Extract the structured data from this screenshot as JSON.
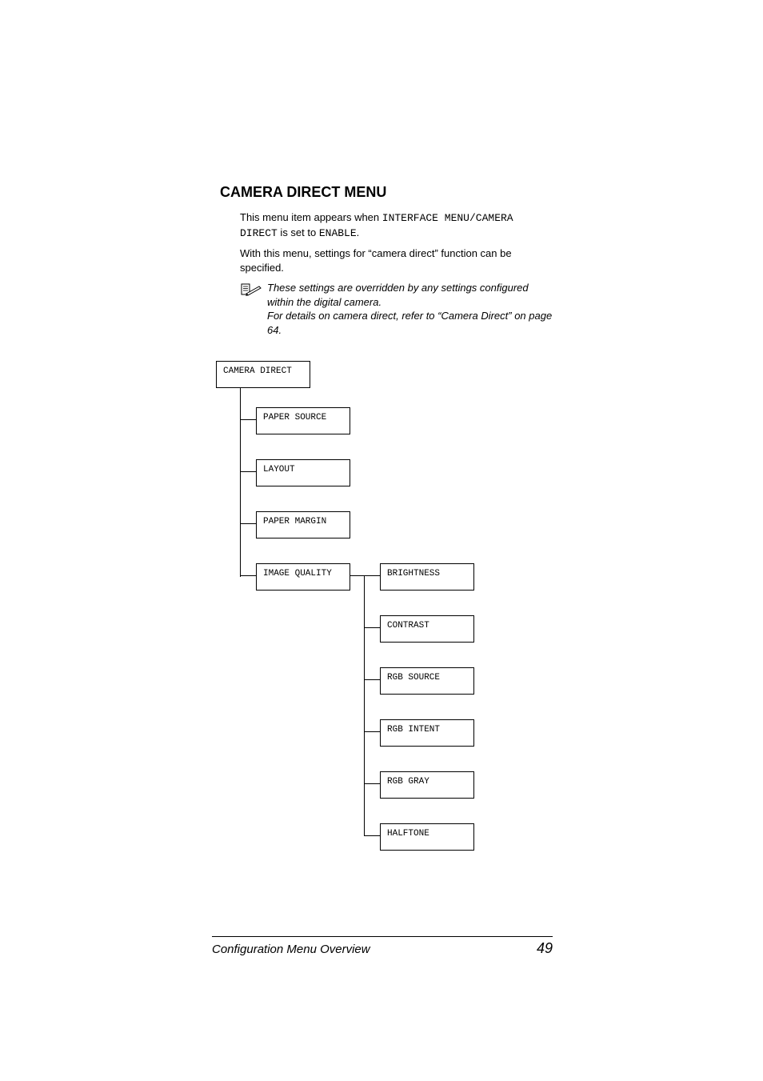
{
  "heading": "CAMERA DIRECT MENU",
  "intro": {
    "part1": "This menu item appears when ",
    "code1": "INTERFACE MENU/CAMERA DIRECT",
    "part2": " is set to ",
    "code2": "ENABLE",
    "part3": "."
  },
  "line2": "With this menu, settings for “camera direct” function can be specified.",
  "note": {
    "l1": "These settings are overridden by any settings configured within the digital camera.",
    "l2": "For details on camera direct, refer to “Camera Direct” on page 64."
  },
  "tree": {
    "root": "CAMERA DIRECT",
    "c1": "PAPER SOURCE",
    "c2": "LAYOUT",
    "c3": "PAPER MARGIN",
    "c4": "IMAGE QUALITY",
    "g1": "BRIGHTNESS",
    "g2": "CONTRAST",
    "g3": "RGB SOURCE",
    "g4": "RGB INTENT",
    "g5": "RGB GRAY",
    "g6": "HALFTONE"
  },
  "footer": {
    "left": "Configuration Menu Overview",
    "right": "49"
  }
}
